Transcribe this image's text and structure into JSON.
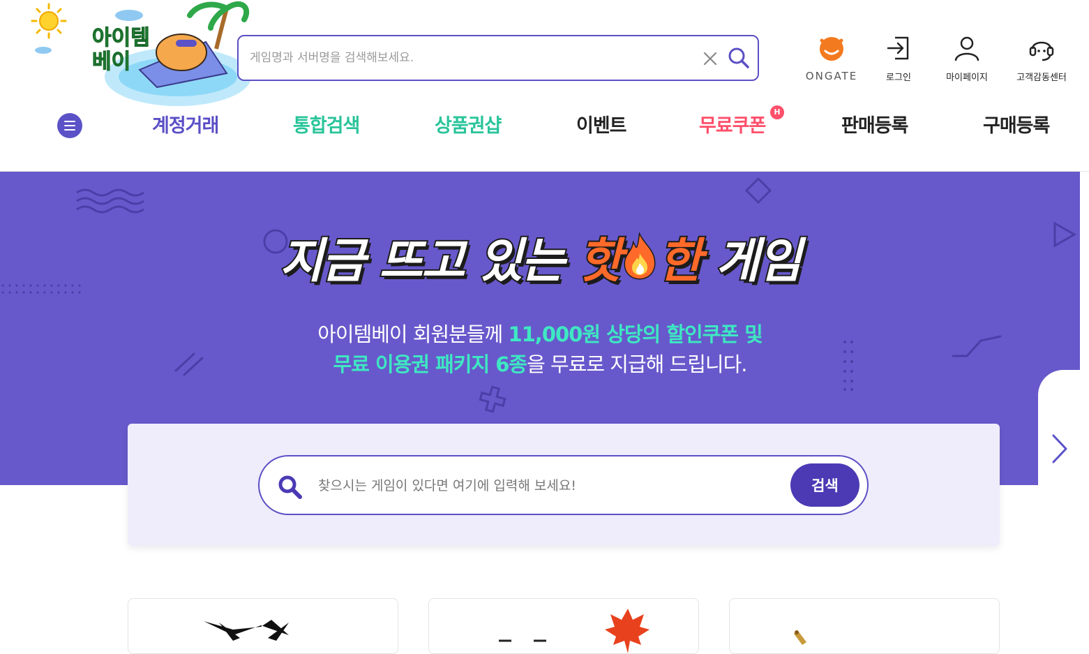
{
  "logo": {
    "line1": "아이템",
    "line2": "베이"
  },
  "header": {
    "search_placeholder": "게임명과 서버명을 검색해보세요.",
    "utilities": [
      {
        "label": "ONGATE",
        "icon": "ongate-logo-icon"
      },
      {
        "label": "로그인",
        "icon": "login-icon"
      },
      {
        "label": "마이페이지",
        "icon": "user-icon"
      },
      {
        "label": "고객감동센터",
        "icon": "headset-icon"
      }
    ]
  },
  "nav": {
    "items": [
      {
        "label": "계정거래",
        "color": "#5a4fc6"
      },
      {
        "label": "통합검색",
        "color": "#29c49a"
      },
      {
        "label": "상품권샵",
        "color": "#29c49a"
      },
      {
        "label": "이벤트",
        "color": "#222222"
      },
      {
        "label": "무료쿠폰",
        "color": "#ff4f6a",
        "badge": "H"
      },
      {
        "label": "판매등록",
        "color": "#222222"
      },
      {
        "label": "구매등록",
        "color": "#222222"
      }
    ]
  },
  "banner": {
    "title_part1": "지금 뜨고 있는 ",
    "title_hot1": "핫",
    "title_hot2": "한",
    "title_part2": " 게임",
    "sub_line1_plain": "아이템베이 회원분들께 ",
    "sub_line1_accent": "11,000원 상당의 할인쿠폰 및",
    "sub_line2_accent": "무료 이용권 패키지 6종",
    "sub_line2_plain": "을 무료로 지급해 드립니다.",
    "bg_color": "#6759cb",
    "accent_color": "#3ee8c2"
  },
  "main_search": {
    "placeholder": "찾으시는 게임이 있다면 여기에 입력해 보세요!",
    "button_label": "검색"
  }
}
